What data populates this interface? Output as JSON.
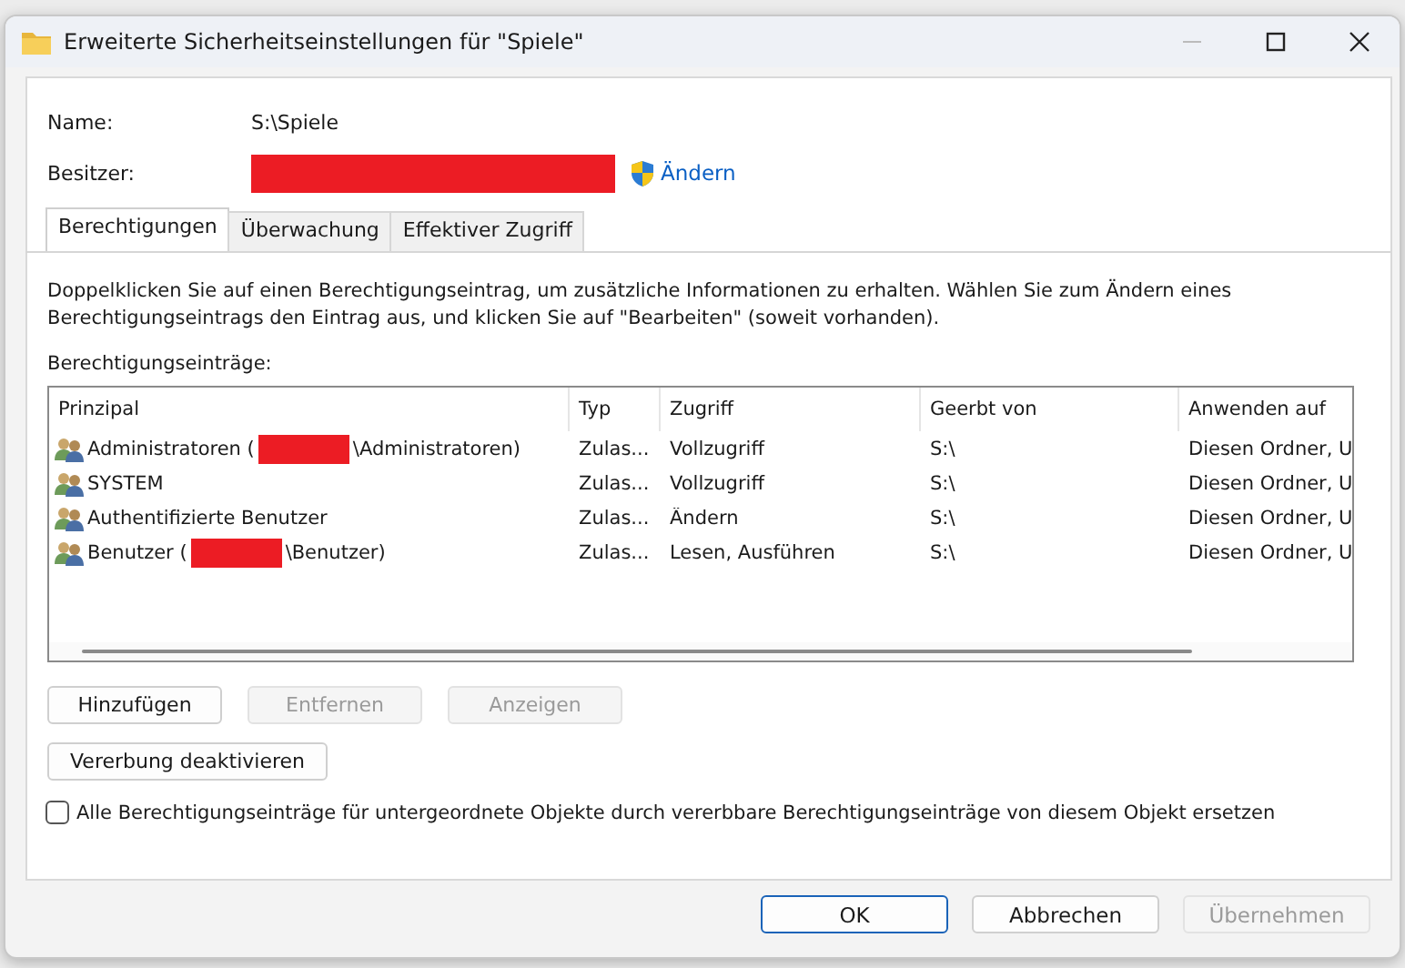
{
  "window": {
    "title": "Erweiterte Sicherheitseinstellungen für \"Spiele\""
  },
  "name": {
    "label": "Name:",
    "value": "S:\\Spiele"
  },
  "owner": {
    "label": "Besitzer:",
    "redacted": true,
    "link": "Ändern"
  },
  "tabs": [
    {
      "label": "Berechtigungen",
      "selected": true
    },
    {
      "label": "Überwachung",
      "selected": false
    },
    {
      "label": "Effektiver Zugriff",
      "selected": false
    }
  ],
  "info": "Doppelklicken Sie auf einen Berechtigungseintrag, um zusätzliche Informationen zu erhalten. Wählen Sie zum Ändern eines Berechtigungseintrags den Eintrag aus, und klicken Sie auf \"Bearbeiten\" (soweit vorhanden).",
  "entries_label": "Berechtigungseinträge:",
  "table": {
    "columns": [
      "Prinzipal",
      "Typ",
      "Zugriff",
      "Geerbt von",
      "Anwenden auf"
    ],
    "rows": [
      {
        "principal": "Administratoren (",
        "redacted": true,
        "principal_suffix": "\\Administratoren)",
        "type": "Zulas...",
        "access": "Vollzugriff",
        "inherited": "S:\\",
        "applies": "Diesen Ordner, U"
      },
      {
        "principal": "SYSTEM",
        "redacted": false,
        "type": "Zulas...",
        "access": "Vollzugriff",
        "inherited": "S:\\",
        "applies": "Diesen Ordner, U"
      },
      {
        "principal": "Authentifizierte Benutzer",
        "redacted": false,
        "type": "Zulas...",
        "access": "Ändern",
        "inherited": "S:\\",
        "applies": "Diesen Ordner, U"
      },
      {
        "principal": "Benutzer (",
        "redacted": true,
        "principal_suffix": "\\Benutzer)",
        "type": "Zulas...",
        "access": "Lesen, Ausführen",
        "inherited": "S:\\",
        "applies": "Diesen Ordner, U"
      }
    ]
  },
  "action_buttons": [
    {
      "label": "Hinzufügen",
      "disabled": false
    },
    {
      "label": "Entfernen",
      "disabled": true
    },
    {
      "label": "Anzeigen",
      "disabled": true
    }
  ],
  "inheritance_button": {
    "label": "Vererbung deaktivieren",
    "disabled": false
  },
  "replace_checkbox": {
    "label": "Alle Berechtigungseinträge für untergeordnete Objekte durch vererbbare Berechtigungseinträge von diesem Objekt ersetzen",
    "checked": false
  },
  "footer_buttons": [
    {
      "label": "OK",
      "disabled": false,
      "default": true
    },
    {
      "label": "Abbrechen",
      "disabled": false,
      "default": false
    },
    {
      "label": "Übernehmen",
      "disabled": true,
      "default": false
    }
  ]
}
